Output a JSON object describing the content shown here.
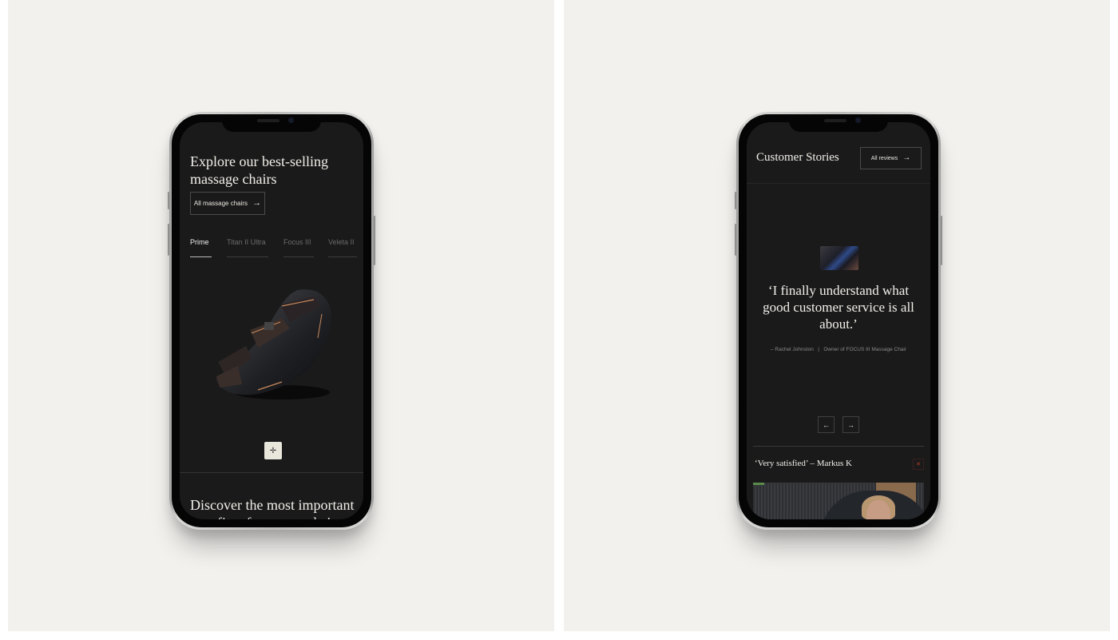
{
  "screen1": {
    "title": "Explore our best-selling massage chairs",
    "button_label": "All massage chairs",
    "button_icon": "arrow-right-icon",
    "tabs": [
      {
        "label": "Prime",
        "active": true
      },
      {
        "label": "Titan II Ultra",
        "active": false
      },
      {
        "label": "Focus III",
        "active": false
      },
      {
        "label": "Veleta II",
        "active": false
      }
    ],
    "product_image": "massage-chair-prime",
    "hotspot_icon": "crosshair-icon",
    "next_section_title": "Discover the most important benefits of massage chairs"
  },
  "screen2": {
    "title": "Customer Stories",
    "button_label": "All reviews",
    "button_icon": "arrow-right-icon",
    "testimonial": {
      "quote": "‘I finally understand what good customer service is all about.’",
      "author": "– Rachel Johnston",
      "separator": "|",
      "product": "Owner of FOCUS III  Massage Chair"
    },
    "prev_icon": "arrow-left-icon",
    "next_icon": "arrow-right-icon",
    "review": {
      "title": "‘Very satisfied’ – Markus K",
      "expand_icon": "expand-icon"
    }
  },
  "colors": {
    "background": "#f2f1ee",
    "screen": "#1a1a1a",
    "text_light": "#f1efe9",
    "muted": "#6b6b6b",
    "hotspot": "#e9e6dc",
    "accent_red": "#c0392b"
  }
}
